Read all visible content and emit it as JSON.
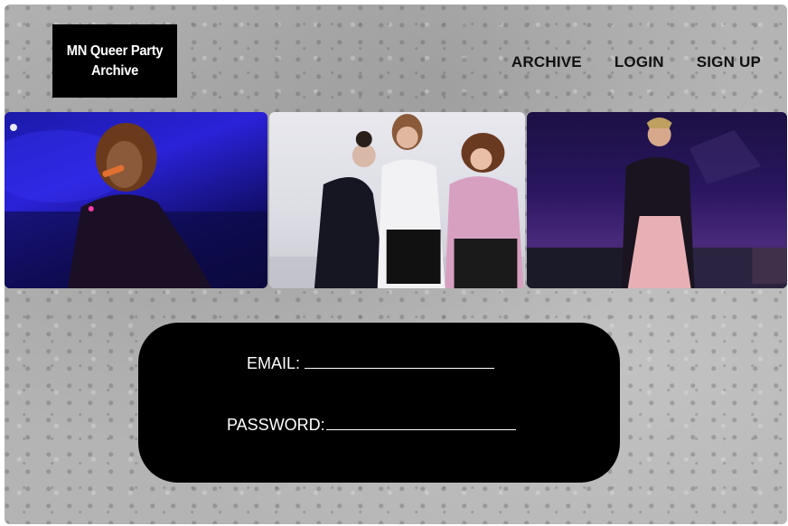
{
  "header": {
    "logo_line1": "MN Queer Party",
    "logo_line2": "Archive",
    "nav": {
      "archive": "ARCHIVE",
      "login": "LOGIN",
      "signup": "SIGN UP"
    }
  },
  "photos": [
    {
      "name": "party-photo-performer-blue"
    },
    {
      "name": "party-photo-group-white-backdrop"
    },
    {
      "name": "party-photo-stage-performer"
    }
  ],
  "login_form": {
    "email_label": "EMAIL:",
    "password_label": "PASSWORD:"
  },
  "colors": {
    "background": "#b4b4b4",
    "panel": "#000000",
    "text_light": "#ffffff",
    "nav_text": "#111111"
  }
}
